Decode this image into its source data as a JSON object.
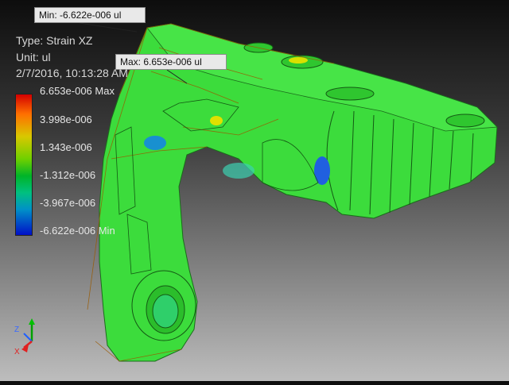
{
  "probes": {
    "min_label": "Min: -6.622e-006 ul",
    "max_label": "Max: 6.653e-006 ul"
  },
  "info": {
    "type": "Type: Strain XZ",
    "unit": "Unit: ul",
    "date": "2/7/2016, 10:13:28 AM"
  },
  "legend": {
    "values": [
      "6.653e-006 Max",
      "3.998e-006",
      "1.343e-006",
      "-1.312e-006",
      "-3.967e-006",
      "-6.622e-006 Min"
    ],
    "colors": [
      "#d40000",
      "#ff7000",
      "#d8c800",
      "#6fd000",
      "#00b428",
      "#00c080",
      "#0090c8",
      "#0010c8"
    ]
  },
  "triad": {
    "x": "X",
    "z": "Z"
  }
}
